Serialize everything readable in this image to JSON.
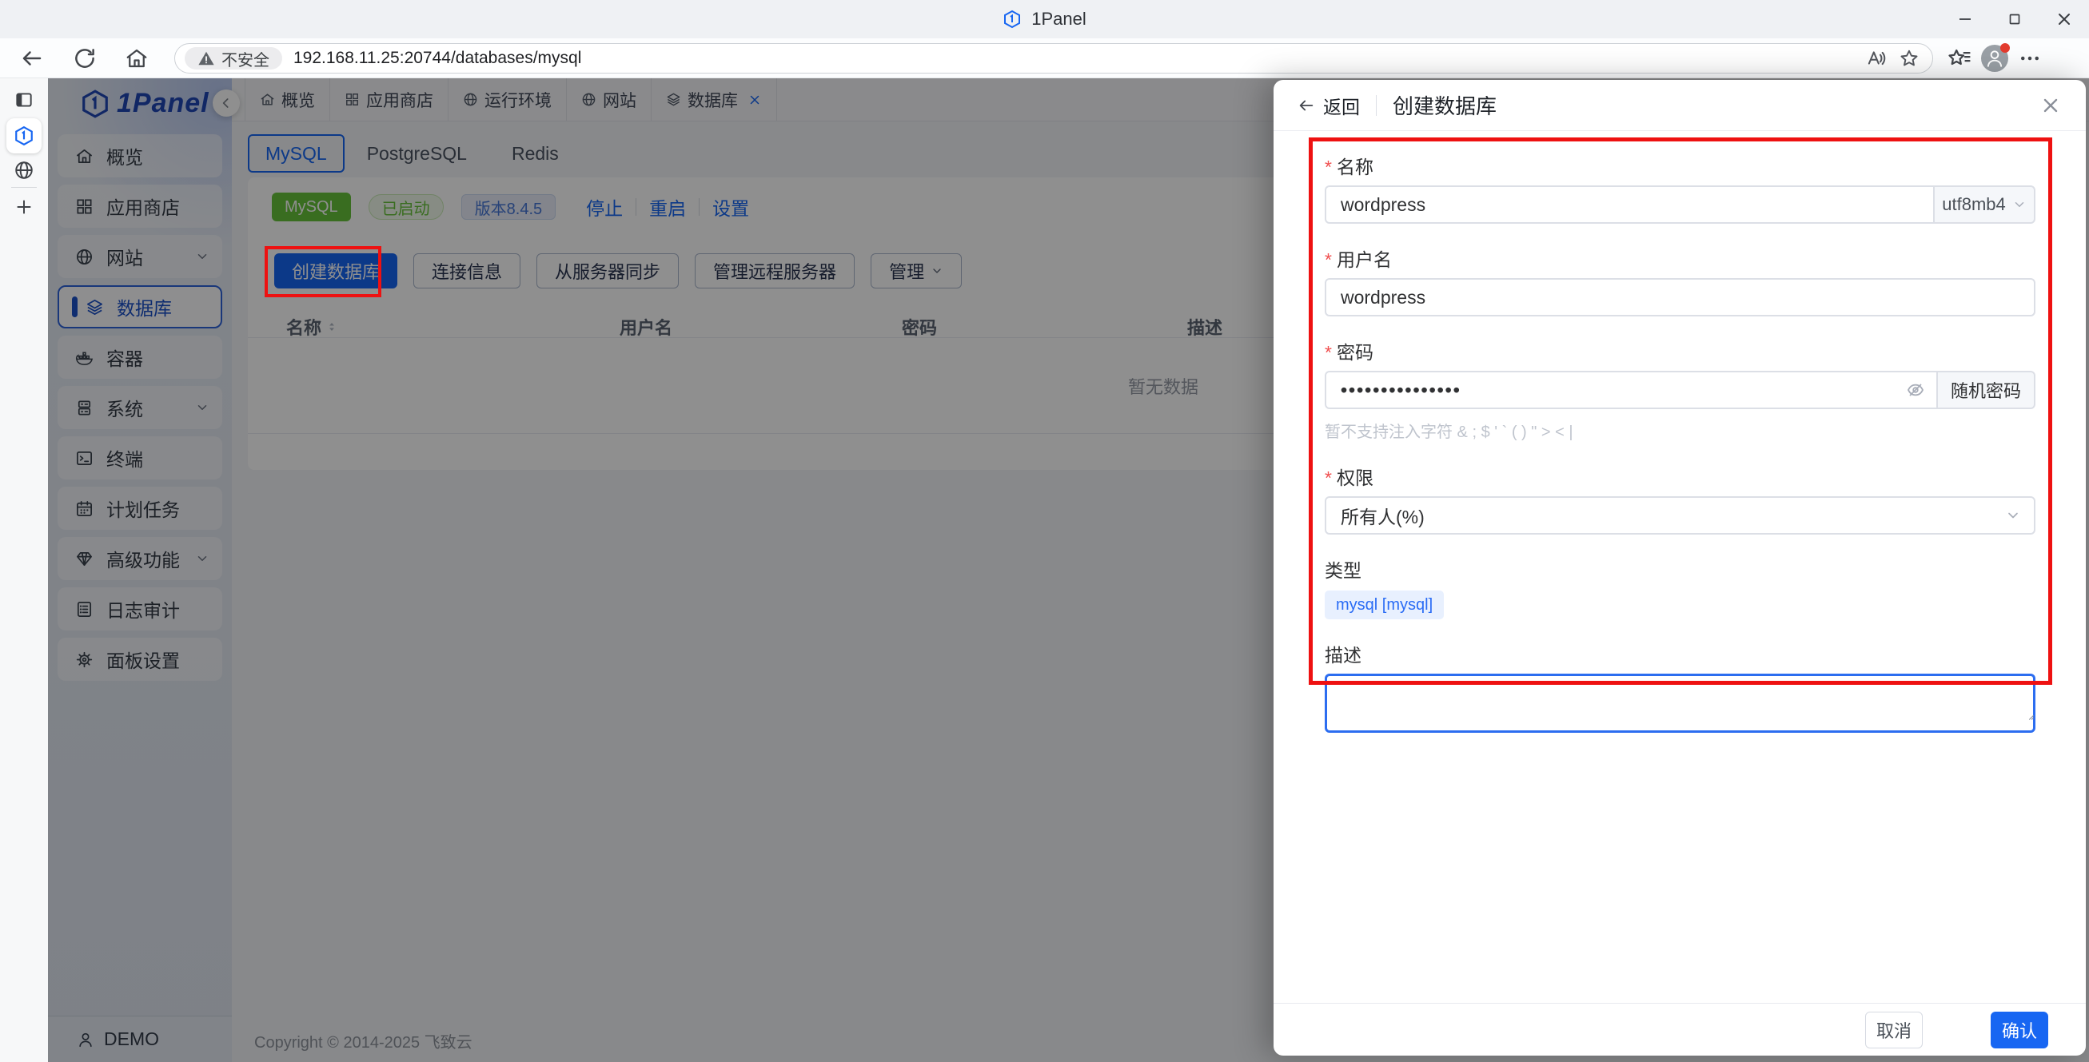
{
  "browser": {
    "window_title": "1Panel",
    "security_label": "不安全",
    "url": "192.168.11.25:20744/databases/mysql"
  },
  "sidebar": {
    "logo_text": "1Panel",
    "items": [
      {
        "label": "概览"
      },
      {
        "label": "应用商店"
      },
      {
        "label": "网站"
      },
      {
        "label": "数据库"
      },
      {
        "label": "容器"
      },
      {
        "label": "系统"
      },
      {
        "label": "终端"
      },
      {
        "label": "计划任务"
      },
      {
        "label": "高级功能"
      },
      {
        "label": "日志审计"
      },
      {
        "label": "面板设置"
      }
    ],
    "user": "DEMO"
  },
  "apptabs": [
    {
      "label": "概览"
    },
    {
      "label": "应用商店"
    },
    {
      "label": "运行环境"
    },
    {
      "label": "网站"
    },
    {
      "label": "数据库"
    }
  ],
  "main": {
    "db_tabs": {
      "active": "MySQL",
      "tab2": "PostgreSQL",
      "tab3": "Redis"
    },
    "status": {
      "engine_tag": "MySQL",
      "state_tag": "已启动",
      "version_tag": "版本8.4.5",
      "action_stop": "停止",
      "action_restart": "重启",
      "action_settings": "设置"
    },
    "buttons": {
      "create": "创建数据库",
      "conn_info": "连接信息",
      "sync": "从服务器同步",
      "remote": "管理远程服务器",
      "manage": "管理"
    },
    "table": {
      "col_name": "名称",
      "col_user": "用户名",
      "col_password": "密码",
      "col_desc": "描述",
      "empty_text": "暂无数据"
    },
    "copyright": "Copyright © 2014-2025 飞致云"
  },
  "drawer": {
    "back_label": "返回",
    "title": "创建数据库",
    "fields": {
      "name": {
        "label": "名称",
        "value": "wordpress",
        "charset": "utf8mb4"
      },
      "username": {
        "label": "用户名",
        "value": "wordpress"
      },
      "password": {
        "label": "密码",
        "value": "•••••••••••••••",
        "random_button": "随机密码",
        "hint": "暂不支持注入字符 & ; $ ' ` ( ) \" > < |"
      },
      "permission": {
        "label": "权限",
        "value": "所有人(%)"
      },
      "type": {
        "label": "类型",
        "tag": "mysql [mysql]"
      },
      "description": {
        "label": "描述",
        "value": ""
      }
    },
    "footer": {
      "cancel": "取消",
      "confirm": "确认"
    }
  },
  "colors": {
    "primary_blue": "#1766f2",
    "success_green": "#67c23a",
    "annotation_red": "#ee1111"
  }
}
